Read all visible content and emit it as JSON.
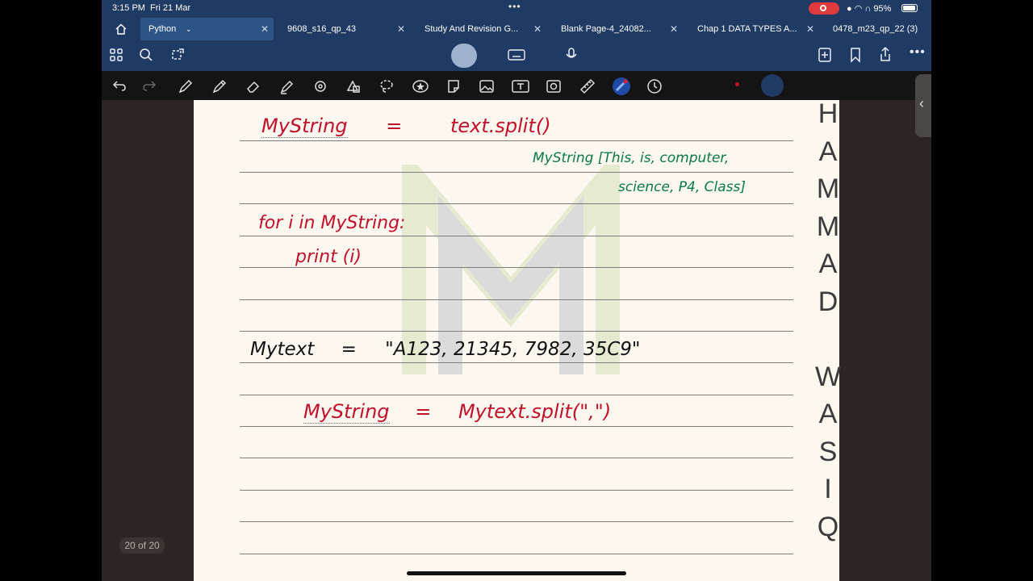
{
  "status": {
    "time": "3:15 PM",
    "date": "Fri 21 Mar",
    "battery": "95%"
  },
  "tabs": [
    {
      "label": "Python",
      "active": true
    },
    {
      "label": "9608_s16_qp_43"
    },
    {
      "label": "Study And Revision G..."
    },
    {
      "label": "Blank Page-4_24082..."
    },
    {
      "label": "Chap 1 DATA TYPES A..."
    },
    {
      "label": "0478_m23_qp_22 (3)"
    }
  ],
  "toolbar_top": {
    "left_icons": [
      "grid-icon",
      "search-icon",
      "lasso-share-icon"
    ],
    "center_icons": [
      "pen-mode-icon",
      "keyboard-icon",
      "microphone-icon"
    ],
    "right_icons": [
      "add-page-icon",
      "bookmark-icon",
      "share-icon",
      "more-icon"
    ]
  },
  "toolbar_tools": [
    "undo-icon",
    "redo-icon",
    "pen-icon",
    "pencil-icon",
    "eraser-icon",
    "highlighter-icon",
    "shapes-icon",
    "elements-icon",
    "lasso-icon",
    "star-icon",
    "sticker-icon",
    "image-icon",
    "text-icon",
    "camera-icon",
    "ruler-icon",
    "laser-icon",
    "timer-icon"
  ],
  "colors": {
    "bar": "#1f3a63",
    "ink_red": "#c3102a",
    "ink_green": "#0a7a44",
    "paper": "#fcf8ef"
  },
  "notes": {
    "line1": {
      "left": "MyString",
      "eq": "=",
      "right": "text.split()"
    },
    "green1": "MyString [This, is, computer,",
    "green2": "science, P4, Class]",
    "for_line": "for i in MyString:",
    "print_line": "print (i)",
    "mytext": {
      "left": "Mytext",
      "eq": "=",
      "right": "\"A123, 21345, 7982, 35C9\""
    },
    "last": {
      "left": "MyString",
      "eq": "=",
      "right": "Mytext.split(\",\")"
    }
  },
  "watermark_letters": [
    "H",
    "A",
    "M",
    "M",
    "A",
    "D",
    "",
    "W",
    "A",
    "S",
    "I",
    "Q"
  ],
  "page_indicator": "20 of 20"
}
